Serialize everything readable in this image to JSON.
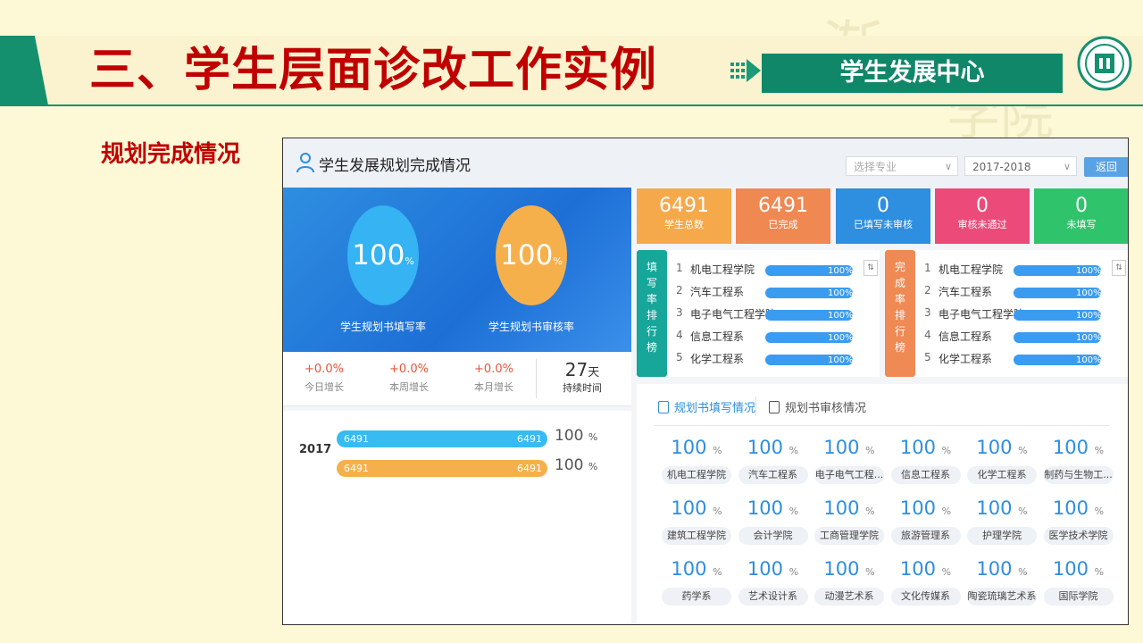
{
  "slide": {
    "title": "三、学生层面诊改工作实例",
    "center_badge": "学生发展中心",
    "section_label": "规划完成情况"
  },
  "app": {
    "title": "学生发展规划完成情况",
    "major_select_placeholder": "选择专业",
    "year_select_value": "2017-2018",
    "back_label": "返回"
  },
  "rates": {
    "fill_rate": "100",
    "fill_label": "学生规划书填写率",
    "review_rate": "100",
    "review_label": "学生规划书审核率",
    "percent_unit": "%"
  },
  "growth": {
    "today_value": "+0.0%",
    "today_label": "今日增长",
    "week_value": "+0.0%",
    "week_label": "本周增长",
    "month_value": "+0.0%",
    "month_label": "本月增长",
    "days_value": "27",
    "days_unit": "天",
    "days_label": "持续时间"
  },
  "year_bars": {
    "year": "2017",
    "fill": {
      "left": "6491",
      "right": "6491",
      "pct": "100",
      "unit": "%"
    },
    "review": {
      "left": "6491",
      "right": "6491",
      "pct": "100",
      "unit": "%"
    }
  },
  "cards": [
    {
      "value": "6491",
      "label": "学生总数"
    },
    {
      "value": "6491",
      "label": "已完成"
    },
    {
      "value": "0",
      "label": "已填写未审核"
    },
    {
      "value": "0",
      "label": "审核未通过"
    },
    {
      "value": "0",
      "label": "未填写"
    }
  ],
  "rank_fill": {
    "tab": [
      "填",
      "写",
      "率",
      "排",
      "行",
      "榜"
    ],
    "sort_icon": "⇅",
    "items": [
      {
        "idx": "1",
        "name": "机电工程学院",
        "pct": "100%"
      },
      {
        "idx": "2",
        "name": "汽车工程系",
        "pct": "100%"
      },
      {
        "idx": "3",
        "name": "电子电气工程学院",
        "pct": "100%"
      },
      {
        "idx": "4",
        "name": "信息工程系",
        "pct": "100%"
      },
      {
        "idx": "5",
        "name": "化学工程系",
        "pct": "100%"
      }
    ]
  },
  "rank_done": {
    "tab": [
      "完",
      "成",
      "率",
      "排",
      "行",
      "榜"
    ],
    "sort_icon": "⇅",
    "items": [
      {
        "idx": "1",
        "name": "机电工程学院",
        "pct": "100%"
      },
      {
        "idx": "2",
        "name": "汽车工程系",
        "pct": "100%"
      },
      {
        "idx": "3",
        "name": "电子电气工程学院",
        "pct": "100%"
      },
      {
        "idx": "4",
        "name": "信息工程系",
        "pct": "100%"
      },
      {
        "idx": "5",
        "name": "化学工程系",
        "pct": "100%"
      }
    ]
  },
  "dept_tabs": {
    "fill": "规划书填写情况",
    "review": "规划书审核情况"
  },
  "depts": [
    {
      "pct": "100",
      "name": "机电工程学院"
    },
    {
      "pct": "100",
      "name": "汽车工程系"
    },
    {
      "pct": "100",
      "name": "电子电气工程..."
    },
    {
      "pct": "100",
      "name": "信息工程系"
    },
    {
      "pct": "100",
      "name": "化学工程系"
    },
    {
      "pct": "100",
      "name": "制药与生物工..."
    },
    {
      "pct": "100",
      "name": "建筑工程学院"
    },
    {
      "pct": "100",
      "name": "会计学院"
    },
    {
      "pct": "100",
      "name": "工商管理学院"
    },
    {
      "pct": "100",
      "name": "旅游管理系"
    },
    {
      "pct": "100",
      "name": "护理学院"
    },
    {
      "pct": "100",
      "name": "医学技术学院"
    },
    {
      "pct": "100",
      "name": "药学系"
    },
    {
      "pct": "100",
      "name": "艺术设计系"
    },
    {
      "pct": "100",
      "name": "动漫艺术系"
    },
    {
      "pct": "100",
      "name": "文化传媒系"
    },
    {
      "pct": "100",
      "name": "陶瓷琉璃艺术系"
    },
    {
      "pct": "100",
      "name": "国际学院"
    }
  ],
  "dept_unit": "%"
}
